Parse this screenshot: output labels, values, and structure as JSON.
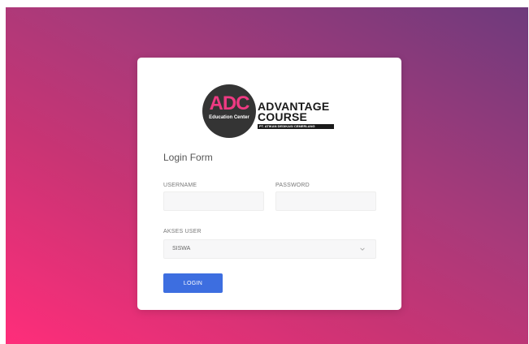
{
  "logo": {
    "abbr": "ADC",
    "tagline": "Education Center",
    "name_line1": "ADVANTAGE",
    "name_line2": "COURSE",
    "company": "PT. ATIKAN DEDIKASI CEMERLANG"
  },
  "form": {
    "title": "Login Form",
    "username_label": "USERNAME",
    "username_value": "",
    "password_label": "PASSWORD",
    "password_value": "",
    "akses_label": "AKSES USER",
    "akses_selected": "SISWA",
    "login_label": "LOGIN"
  },
  "icons": {
    "select_arrow": "chevron-down-icon"
  },
  "colors": {
    "background_start": "#ff2d7a",
    "background_end": "#6e3a7c",
    "logo_accent": "#ee3a82",
    "button": "#3d6ee0"
  }
}
